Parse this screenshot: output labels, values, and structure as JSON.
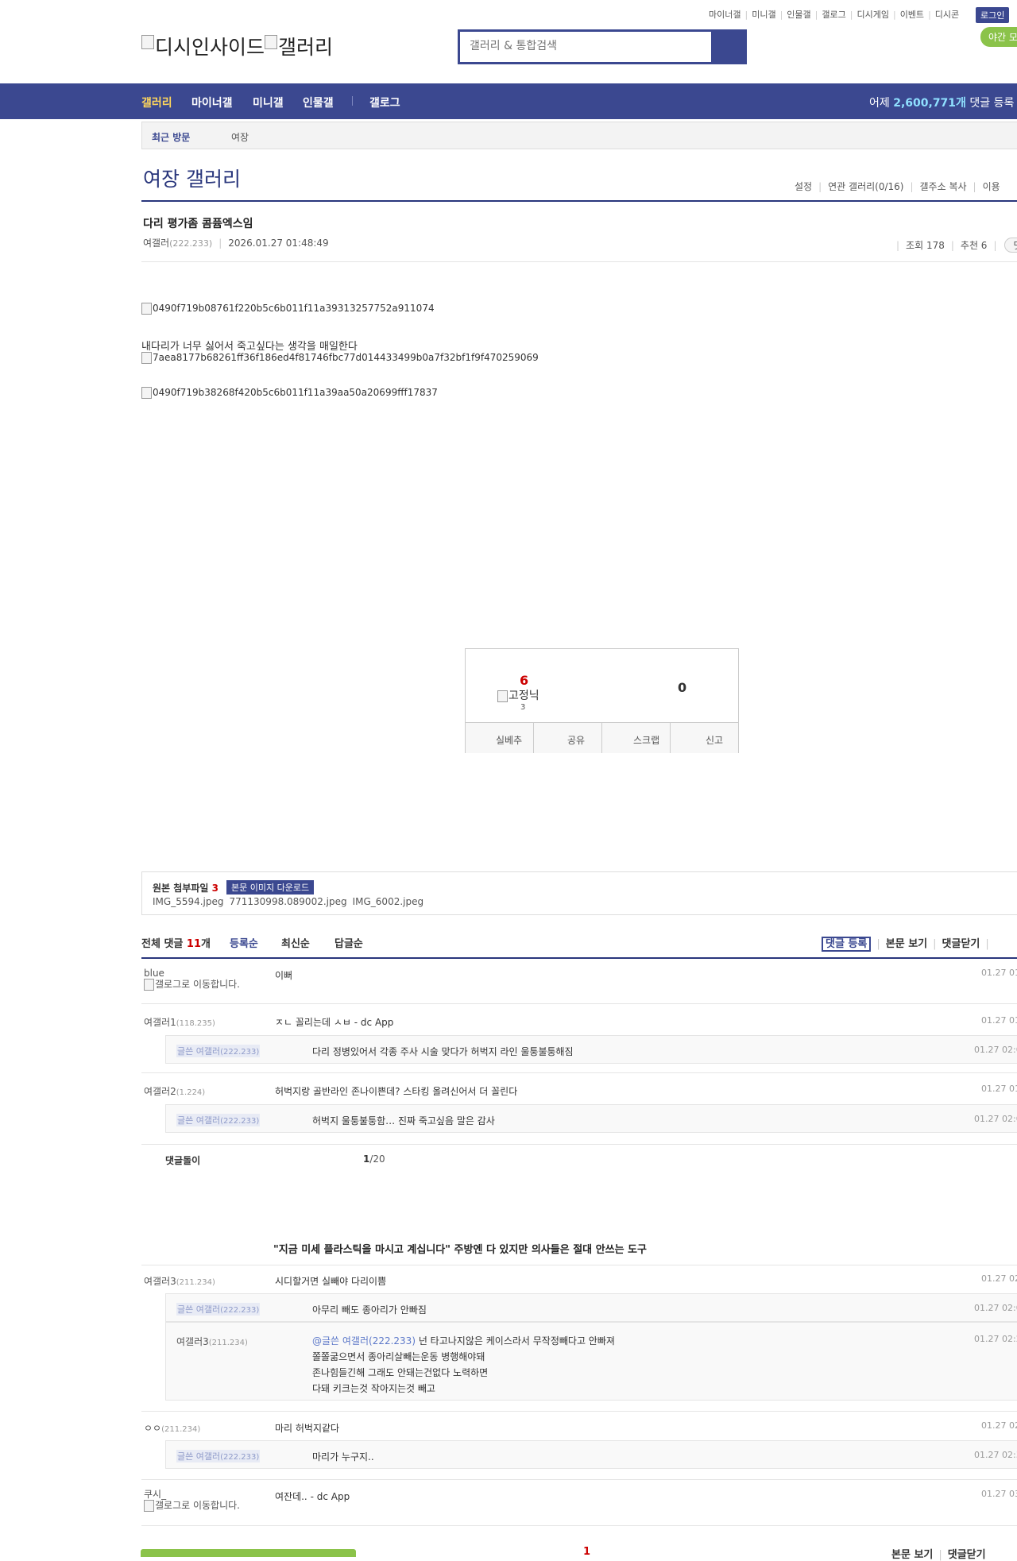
{
  "util_links": [
    "마이너갤",
    "미니갤",
    "인물갤",
    "갤로그",
    "디시게임",
    "이벤트",
    "디시콘"
  ],
  "login_label": "로그인",
  "night_mode_label": "야간 모",
  "logo_alt_1": "디시인사이드",
  "logo_alt_2": "갤러리",
  "search_placeholder": "갤러리 & 통합검색",
  "gnb": {
    "items": [
      "갤러리",
      "마이너갤",
      "미니갤",
      "인물갤",
      "갤로그"
    ],
    "stat_prefix": "어제 ",
    "stat_value": "2,600,771개",
    "stat_suffix": " 댓글 등록"
  },
  "recent_visit": {
    "label": "최근 방문",
    "gallery": "여장"
  },
  "gallery_title": "여장 갤러리",
  "gallery_tools": [
    "설정",
    "연관 갤러리(0/16)",
    "갤주소 복사",
    "이용"
  ],
  "post": {
    "title": "다리 평가좀 콤퓸엑스임",
    "author": "여갤러",
    "author_ip": "(222.233)",
    "date": "2026.01.27 01:48:49",
    "views_label": "조회 178",
    "recommend_label": "추천 6",
    "comment_pill": "댓",
    "image_1": "0490f719b08761f220b5c6b011f11a39313257752a911074",
    "text_1": "내다리가 너무 싫어서 죽고싶다는 생각을 매일한다",
    "image_2": "7aea8177b68261ff36f186ed4f81746fbc77d014433499b0a7f32bf1f9f470259069",
    "image_3": "0490f719b38268f420b5c6b011f11a39aa50a20699fff17837"
  },
  "vote": {
    "up_count": "6",
    "fixed_alt": "고정닉",
    "fixed_count": "3",
    "down_count": "0",
    "buttons": [
      "실베추",
      "공유",
      "스크랩",
      "신고"
    ]
  },
  "attachment": {
    "label": "원본 첨부파일 ",
    "count": "3",
    "download_label": "본문 이미지 다운로드",
    "files": [
      "IMG_5594.jpeg",
      "771130998.089002.jpeg",
      "IMG_6002.jpeg"
    ]
  },
  "comment_header": {
    "label": "전체 댓글 ",
    "count": "11",
    "unit": "개",
    "orders": [
      "등록순",
      "최신순",
      "답글순"
    ],
    "tools": [
      "댓글 등록",
      "본문 보기",
      "댓글닫기"
    ]
  },
  "gallog_alt": "갤로그로 이동합니다.",
  "comments": [
    {
      "nick": "blue",
      "text": "이뻐",
      "date": "01.27 01"
    },
    {
      "nick": "여갤러1",
      "ip": "(118.235)",
      "text": "ㅈㄴ 꼴리는데 ㅅㅂ - dc App",
      "date": "01.27 01"
    },
    {
      "writer": "글쓴 여갤러",
      "ip": "(222.233)",
      "text": "다리 정병있어서 각종 주사 시술 맞다가 허벅지 라인 울퉁불퉁해짐",
      "date": "01.27 02:0"
    },
    {
      "nick": "여갤러2",
      "ip": "(1.224)",
      "text": "허벅지랑 골반라인 존나이쁜데? 스타킹 올려신어서 더 꼴린다",
      "date": "01.27 01"
    },
    {
      "writer": "글쓴 여갤러",
      "ip": "(222.233)",
      "text": "허벅지 울퉁불퉁함… 진짜 죽고싶음 말은 감사",
      "date": "01.27 02:0"
    },
    {
      "nick": "여갤러3",
      "ip": "(211.234)",
      "text": "시디할거면 실빼야 다리이쁨",
      "date": "01.27 02"
    },
    {
      "writer": "글쓴 여갤러",
      "ip": "(222.233)",
      "text": "아무리 빼도 종아리가 안빠짐",
      "date": "01.27 02:0"
    },
    {
      "nick": "여갤러3",
      "ip": "(211.234)",
      "mention": "@글쓴 여갤러(222.233)",
      "lines": [
        " 넌 타고나지않은 케이스라서 무작정빼다고 안빠져",
        "쫄쫄굶으면서 종아리살빼는운동 병행해야돼",
        "존나힘들긴해 그래도 안돼는건없다 노력하면",
        "다돼 키크는것 작아지는것 빼고"
      ],
      "date": "01.27 02:2"
    },
    {
      "nick": "ㅇㅇ",
      "ip": "(211.234)",
      "text": "마리 허벅지같다",
      "date": "01.27 02"
    },
    {
      "writer": "글쓴 여갤러",
      "ip": "(222.233)",
      "text": "마리가 누구지..",
      "date": "01.27 02:3"
    },
    {
      "nick": "쿠시_",
      "text": "여잔데.. - dc App",
      "date": "01.27 03"
    }
  ],
  "dolgi": {
    "label": "댓글돌이",
    "page": "1",
    "total": "/20"
  },
  "ad_text": "\"지금 미세 플라스틱을 마시고 계십니다\" 주방엔 다 있지만 의사들은 절대 안쓰는 도구",
  "pagination_current": "1",
  "bottom_tools": [
    "본문 보기",
    "댓글닫기"
  ],
  "colors": {
    "brand": "#3b4890",
    "accent": "#ffd75c",
    "night": "#8bc34a"
  }
}
